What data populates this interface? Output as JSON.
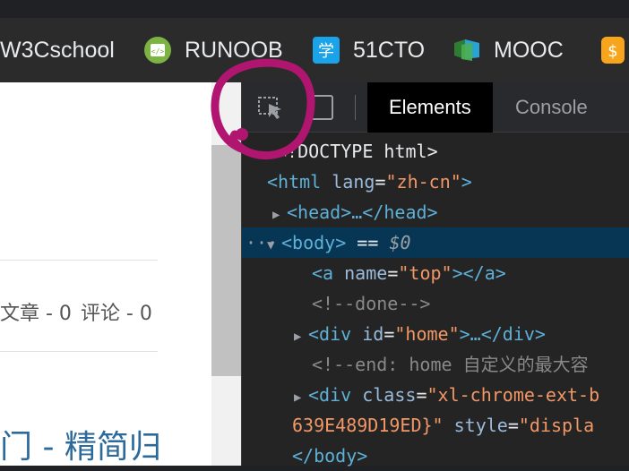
{
  "bookmarks": [
    {
      "label": "W3Cschool",
      "icon": "w3cschool-icon"
    },
    {
      "label": "RUNOOB",
      "icon": "runoob-icon"
    },
    {
      "label": "51CTO",
      "icon": "51cto-icon"
    },
    {
      "label": "MOOC",
      "icon": "mooc-icon"
    },
    {
      "label": "",
      "icon": "orange-s-icon"
    }
  ],
  "page": {
    "stats": [
      "文章 - 0",
      "评论 - 0"
    ],
    "heading": "门 - 精简归"
  },
  "devtools": {
    "tabs": [
      "Elements",
      "Console"
    ],
    "active_tab": "Elements",
    "tree": {
      "doctype": "<!DOCTYPE html>",
      "html_tag": "<html",
      "html_attr": "lang",
      "html_val": "\"zh-cn\"",
      "head": "<head>…</head>",
      "body_open": "<body>",
      "body_eq": "==",
      "body_ref": "$0",
      "a_open": "<a",
      "a_attr": "name",
      "a_val": "\"top\"",
      "a_close": "></a>",
      "comment_done": "<!--done-->",
      "div_home_open": "<div",
      "div_home_attr": "id",
      "div_home_val": "\"home\"",
      "div_home_close": ">…</div>",
      "comment_end": "<!--end: home 自定义的最大容",
      "div_class_open": "<div",
      "div_class_attr": "class",
      "div_class_val": "\"xl-chrome-ext-b",
      "div_class_val2": "639E489D19ED}\"",
      "div_class_attr2": "style",
      "div_class_val3": "\"displa",
      "body_close": "</body>"
    }
  },
  "colors": {
    "selected_row": "#073655",
    "tag": "#5db0d7",
    "attr_value": "#f29766",
    "annotation": "#b0166f"
  }
}
